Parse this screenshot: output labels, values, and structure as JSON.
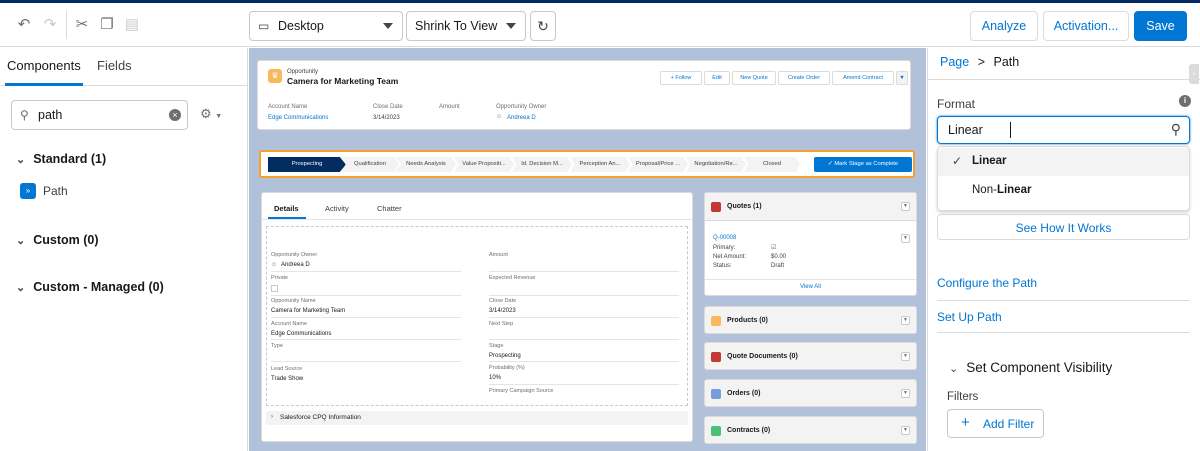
{
  "toolbar": {
    "device_value": "Desktop",
    "zoom_value": "Shrink To View",
    "analyze_label": "Analyze",
    "activation_label": "Activation...",
    "save_label": "Save"
  },
  "left_panel": {
    "tab_components": "Components",
    "tab_fields": "Fields",
    "search_value": "path",
    "standard_label": "Standard (1)",
    "path_item": "Path",
    "custom_label": "Custom (0)",
    "custom_managed_label": "Custom - Managed (0)"
  },
  "record": {
    "object_label": "Opportunity",
    "title": "Camera for Marketing Team",
    "actions": [
      "+ Follow",
      "Edit",
      "New Quote",
      "Create Order",
      "Amend Contract"
    ],
    "highlights": [
      {
        "label": "Account Name",
        "value": "Edge Communications"
      },
      {
        "label": "Close Date",
        "value": "3/14/2023"
      },
      {
        "label": "Amount",
        "value": ""
      },
      {
        "label": "Opportunity Owner",
        "value": "Andreea D"
      }
    ],
    "stages": [
      "Prospecting",
      "Qualification",
      "Needs Analysis",
      "Value Propositi...",
      "Id. Decision M...",
      "Perception An...",
      "Proposal/Price ...",
      "Negotiation/Re...",
      "Closed"
    ],
    "mark_complete": "✓ Mark Stage as Complete",
    "tabs": [
      "Details",
      "Activity",
      "Chatter"
    ],
    "left_fields": [
      {
        "label": "Opportunity Owner",
        "value": "Andreea D"
      },
      {
        "label": "Private",
        "value": ""
      },
      {
        "label": "Opportunity Name",
        "value": "Camera for Marketing Team"
      },
      {
        "label": "Account Name",
        "value": "Edge Communications"
      },
      {
        "label": "Type",
        "value": ""
      },
      {
        "label": "Lead Source",
        "value": "Trade Show"
      }
    ],
    "right_fields": [
      {
        "label": "Amount",
        "value": ""
      },
      {
        "label": "Expected Revenue",
        "value": ""
      },
      {
        "label": "Close Date",
        "value": "3/14/2023"
      },
      {
        "label": "Next Step",
        "value": ""
      },
      {
        "label": "Stage",
        "value": "Prospecting"
      },
      {
        "label": "Probability (%)",
        "value": "10%"
      },
      {
        "label": "Primary Campaign Source",
        "value": ""
      }
    ],
    "cpq_section": "Salesforce CPQ Information",
    "related": {
      "quotes_title": "Quotes (1)",
      "quote_number": "Q-00008",
      "quote_primary_label": "Primary:",
      "quote_net_label": "Net Amount:",
      "quote_net_value": "$0.00",
      "quote_status_label": "Status:",
      "quote_status_value": "Draft",
      "view_all": "View All",
      "products_title": "Products (0)",
      "quote_docs_title": "Quote Documents (0)",
      "orders_title": "Orders (0)",
      "contracts_title": "Contracts (0)"
    }
  },
  "right_panel": {
    "breadcrumb_page": "Page",
    "breadcrumb_sep": ">",
    "breadcrumb_current": "Path",
    "format_label": "Format",
    "format_input": "Linear",
    "option_linear": "Linear",
    "option_nonlinear_prefix": "Non-",
    "option_nonlinear_bold": "Linear",
    "see_how": "See How It Works",
    "configure_path": "Configure the Path",
    "set_up_path": "Set Up Path",
    "visibility_title": "Set Component Visibility",
    "filters_label": "Filters",
    "add_filter": "Add Filter"
  },
  "colors": {
    "accent": "#0176d3",
    "path_active": "#032d60",
    "path_highlight": "#f4a02b"
  }
}
